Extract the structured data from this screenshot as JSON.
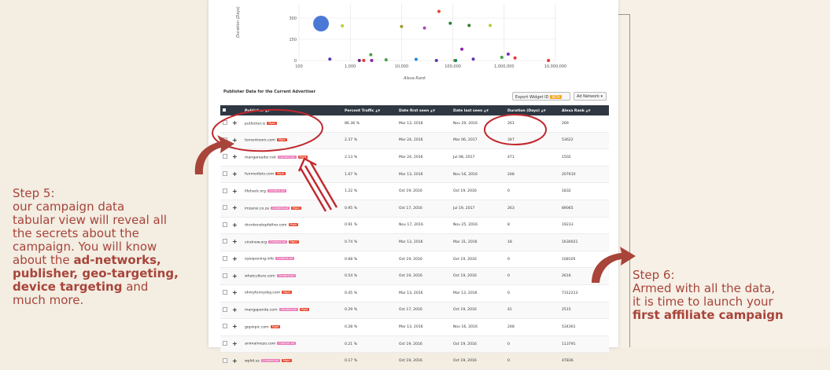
{
  "chart": {
    "y_axis_title": "Duration (Days)",
    "y_ticks": [
      "300",
      "150",
      "0"
    ],
    "x_ticks": [
      "100",
      "1,000",
      "10,000",
      "100,000",
      "1,000,000",
      "10,000,000"
    ],
    "x_axis_title": "Alexa Rank"
  },
  "chart_data": {
    "type": "scatter",
    "xlabel": "Alexa Rank",
    "ylabel": "Duration (Days)",
    "xscale": "log",
    "xlim": [
      100,
      10000000
    ],
    "ylim": [
      0,
      400
    ],
    "points": [
      {
        "x": 269,
        "y": 261,
        "color": "#4a78d6",
        "size": "large"
      },
      {
        "x": 53622,
        "y": 347,
        "color": "#e8452c"
      },
      {
        "x": 1502,
        "y": 0,
        "color": "#6a2b7a"
      },
      {
        "x": 207610,
        "y": 248,
        "color": "#2e7d32"
      },
      {
        "x": 1832,
        "y": 0,
        "color": "#e53935"
      },
      {
        "x": 89065,
        "y": 263,
        "color": "#2e7d32"
      },
      {
        "x": 19233,
        "y": 8,
        "color": "#1e88e5"
      },
      {
        "x": 1630021,
        "y": 18,
        "color": "#e53935"
      },
      {
        "x": 108105,
        "y": 0,
        "color": "#fb8c00"
      },
      {
        "x": 2616,
        "y": 0,
        "color": "#8e24aa"
      },
      {
        "x": 7312213,
        "y": 0,
        "color": "#e53935"
      },
      {
        "x": 2515,
        "y": 41,
        "color": "#43a047"
      },
      {
        "x": 534361,
        "y": 248,
        "color": "#c0ca33"
      },
      {
        "x": 113791,
        "y": 0,
        "color": "#00897b"
      },
      {
        "x": 47836,
        "y": 0,
        "color": "#5e35b1"
      },
      {
        "x": 10000,
        "y": 240,
        "color": "#9e9d24"
      },
      {
        "x": 28000,
        "y": 230,
        "color": "#ab47bc"
      },
      {
        "x": 700,
        "y": 245,
        "color": "#c0ca33"
      },
      {
        "x": 150000,
        "y": 80,
        "color": "#8e24aa"
      },
      {
        "x": 1200000,
        "y": 45,
        "color": "#8e24aa"
      },
      {
        "x": 900000,
        "y": 22,
        "color": "#43a047"
      },
      {
        "x": 250000,
        "y": 10,
        "color": "#5e35b1"
      },
      {
        "x": 400,
        "y": 10,
        "color": "#5e35b1"
      },
      {
        "x": 5000,
        "y": 5,
        "color": "#43a047"
      }
    ]
  },
  "section_title": "Publisher Data for the Current Advertiser",
  "export_button": {
    "label": "Export Widget ID",
    "badge": "BETA"
  },
  "adnetwork_button": {
    "label": "Ad Network ▾"
  },
  "table": {
    "headers": [
      "Publisher",
      "Percent Traffic",
      "Date first seen",
      "Date last seen",
      "Duration (Days)",
      "Alexa Rank"
    ],
    "rows": [
      {
        "publisher": "putlocker.is",
        "tags": [
          "Mgid"
        ],
        "traffic": "86.36 %",
        "first": "Mar 13, 2016",
        "last": "Nov 29, 2016",
        "duration": "261",
        "rank": "269"
      },
      {
        "publisher": "torrentroom.com",
        "tags": [
          "Mgid"
        ],
        "traffic": "2.37 %",
        "first": "Mar 24, 2016",
        "last": "Mar 06, 2017",
        "duration": "347",
        "rank": "53622"
      },
      {
        "publisher": "mangareader.net",
        "tags": [
          "Content.ad",
          "Mgid"
        ],
        "traffic": "2.13 %",
        "first": "Mar 24, 2016",
        "last": "Jul 08, 2017",
        "duration": "471",
        "rank": "1502"
      },
      {
        "publisher": "funmediatv.com",
        "tags": [
          "Mgid"
        ],
        "traffic": "1.67 %",
        "first": "Mar 13, 2016",
        "last": "Nov 16, 2016",
        "duration": "248",
        "rank": "207610"
      },
      {
        "publisher": "lifehack.org",
        "tags": [
          "Content.ad"
        ],
        "traffic": "1.22 %",
        "first": "Oct 19, 2016",
        "last": "Oct 19, 2016",
        "duration": "0",
        "rank": "1832"
      },
      {
        "publisher": "imzansi.co.za",
        "tags": [
          "Content.ad",
          "Mgid"
        ],
        "traffic": "0.95 %",
        "first": "Oct 17, 2016",
        "last": "Jul 19, 2017",
        "duration": "263",
        "rank": "89065"
      },
      {
        "publisher": "drunkenstepfather.com",
        "tags": [
          "Mgid"
        ],
        "traffic": "0.91 %",
        "first": "Nov 17, 2016",
        "last": "Nov 25, 2016",
        "duration": "8",
        "rank": "19233"
      },
      {
        "publisher": "viralnow.org",
        "tags": [
          "Content.ad",
          "Mgid"
        ],
        "traffic": "0.74 %",
        "first": "Mar 13, 2016",
        "last": "Mar 31, 2016",
        "duration": "18",
        "rank": "1630021"
      },
      {
        "publisher": "eyeopening.info",
        "tags": [
          "Content.ad"
        ],
        "traffic": "0.68 %",
        "first": "Oct 19, 2016",
        "last": "Oct 19, 2016",
        "duration": "0",
        "rank": "108105"
      },
      {
        "publisher": "whatculture.com",
        "tags": [
          "Content.ad"
        ],
        "traffic": "0.54 %",
        "first": "Oct 19, 2016",
        "last": "Oct 19, 2016",
        "duration": "0",
        "rank": "2616"
      },
      {
        "publisher": "ohmyfunnyday.com",
        "tags": [
          "Mgid"
        ],
        "traffic": "0.45 %",
        "first": "Mar 13, 2016",
        "last": "Mar 13, 2016",
        "duration": "0",
        "rank": "7312213"
      },
      {
        "publisher": "mangapanda.com",
        "tags": [
          "Content.ad",
          "Mgid"
        ],
        "traffic": "0.29 %",
        "first": "Oct 17, 2016",
        "last": "Oct 19, 2016",
        "duration": "41",
        "rank": "2515"
      },
      {
        "publisher": "gopixpic.com",
        "tags": [
          "Mgid"
        ],
        "traffic": "0.28 %",
        "first": "Mar 13, 2016",
        "last": "Nov 16, 2016",
        "duration": "248",
        "rank": "534361"
      },
      {
        "publisher": "animalmozo.com",
        "tags": [
          "Content.ad"
        ],
        "traffic": "0.21 %",
        "first": "Oct 19, 2016",
        "last": "Oct 19, 2016",
        "duration": "0",
        "rank": "113791"
      },
      {
        "publisher": "wplid.us",
        "tags": [
          "Content.ad",
          "Mgid"
        ],
        "traffic": "0.17 %",
        "first": "Oct 19, 2016",
        "last": "Oct 19, 2016",
        "duration": "0",
        "rank": "47836"
      }
    ]
  },
  "step5": {
    "heading": "Step 5:",
    "lines": [
      "our campaign data",
      "tabular view will reveal all",
      "the secrets about the",
      "campaign. You will know",
      "about the "
    ],
    "bold1": "ad-networks,",
    "bold2": "publisher, geo-targeting,",
    "bold3": "device targeting",
    "tail1": " and",
    "tail2": "much more."
  },
  "step6": {
    "heading": "Step 6:",
    "line1": "Armed with all the data,",
    "line2": "it is time to launch your",
    "bold": "first affiliate campaign"
  },
  "colors": {
    "annotation": "#a8443a",
    "header_bg": "#2e3742",
    "tag_mgid": "#e8452c",
    "tag_content": "#e97ab6"
  }
}
